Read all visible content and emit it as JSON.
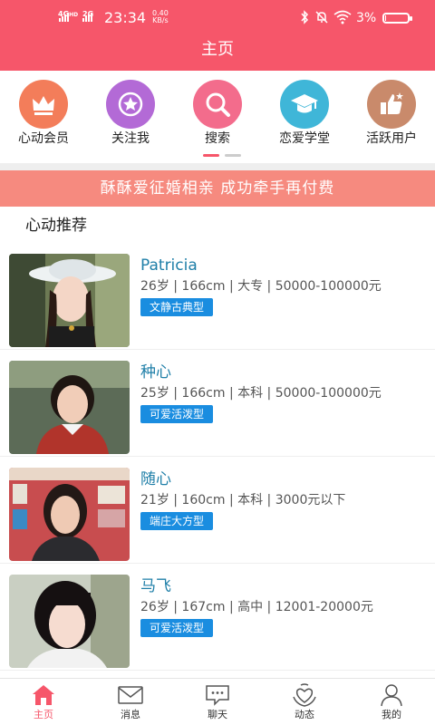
{
  "status_bar": {
    "network": "4G",
    "hd": "HD",
    "network2": "2G",
    "time": "23:34",
    "speed_value": "0.40",
    "speed_unit": "KB/s",
    "battery": "3%"
  },
  "header": {
    "title": "主页"
  },
  "categories": [
    {
      "label": "心动会员",
      "icon": "crown-icon",
      "color": "#f37d5a"
    },
    {
      "label": "关注我",
      "icon": "star-icon",
      "color": "#b36ad6"
    },
    {
      "label": "搜索",
      "icon": "search-icon",
      "color": "#f36c8c"
    },
    {
      "label": "恋爱学堂",
      "icon": "graduation-cap-icon",
      "color": "#3fb6d8"
    },
    {
      "label": "活跃用户",
      "icon": "thumbs-up-icon",
      "color": "#c98a6b"
    }
  ],
  "category_pager": {
    "active_index": 0,
    "count": 2,
    "active_color": "#f6566a",
    "inactive_color": "#cccccc"
  },
  "banner": {
    "text": "酥酥爱征婚相亲 成功牵手再付费"
  },
  "section": {
    "title": "心动推荐"
  },
  "profiles": [
    {
      "name": "Patricia",
      "meta": "26岁 | 166cm | 大专 | 50000-100000元",
      "tag": "文静古典型"
    },
    {
      "name": "种心",
      "meta": "25岁 | 166cm | 本科 | 50000-100000元",
      "tag": "可爱活泼型"
    },
    {
      "name": "随心",
      "meta": "21岁 | 160cm | 本科 | 3000元以下",
      "tag": "端庄大方型"
    },
    {
      "name": "马飞",
      "meta": "26岁 | 167cm | 高中 | 12001-20000元",
      "tag": "可爱活泼型"
    }
  ],
  "bottom_nav": [
    {
      "label": "主页",
      "icon": "home-icon",
      "active": true
    },
    {
      "label": "消息",
      "icon": "envelope-icon",
      "active": false
    },
    {
      "label": "聊天",
      "icon": "chat-icon",
      "active": false
    },
    {
      "label": "动态",
      "icon": "heart-hands-icon",
      "active": false
    },
    {
      "label": "我的",
      "icon": "person-icon",
      "active": false
    }
  ],
  "colors": {
    "accent": "#f6566a",
    "banner": "#f68a7f",
    "name": "#1f7fa8",
    "tag": "#1a8de0"
  }
}
